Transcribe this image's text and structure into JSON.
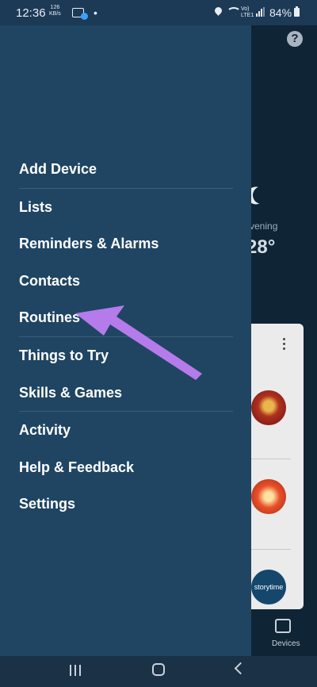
{
  "status_bar": {
    "time": "12:36",
    "kbs_value": "126",
    "kbs_unit": "KB/s",
    "notification_dot": "•",
    "volte_line1": "Vo)",
    "volte_line2": "LTE1",
    "battery": "84%"
  },
  "background_app": {
    "help_label": "?",
    "greeting": "vening",
    "temperature": "28°",
    "skill3_label": "storytime",
    "bottom_tab_label": "Devices"
  },
  "drawer": {
    "menu_items": [
      {
        "label": "Add Device"
      },
      {
        "label": "Lists"
      },
      {
        "label": "Reminders & Alarms"
      },
      {
        "label": "Contacts"
      },
      {
        "label": "Routines"
      },
      {
        "label": "Things to Try"
      },
      {
        "label": "Skills & Games"
      },
      {
        "label": "Activity"
      },
      {
        "label": "Help & Feedback"
      },
      {
        "label": "Settings"
      }
    ]
  },
  "annotation": {
    "color": "#b57bea"
  },
  "colors": {
    "drawer_bg": "#1f4563",
    "status_bg": "#1c3a56"
  }
}
